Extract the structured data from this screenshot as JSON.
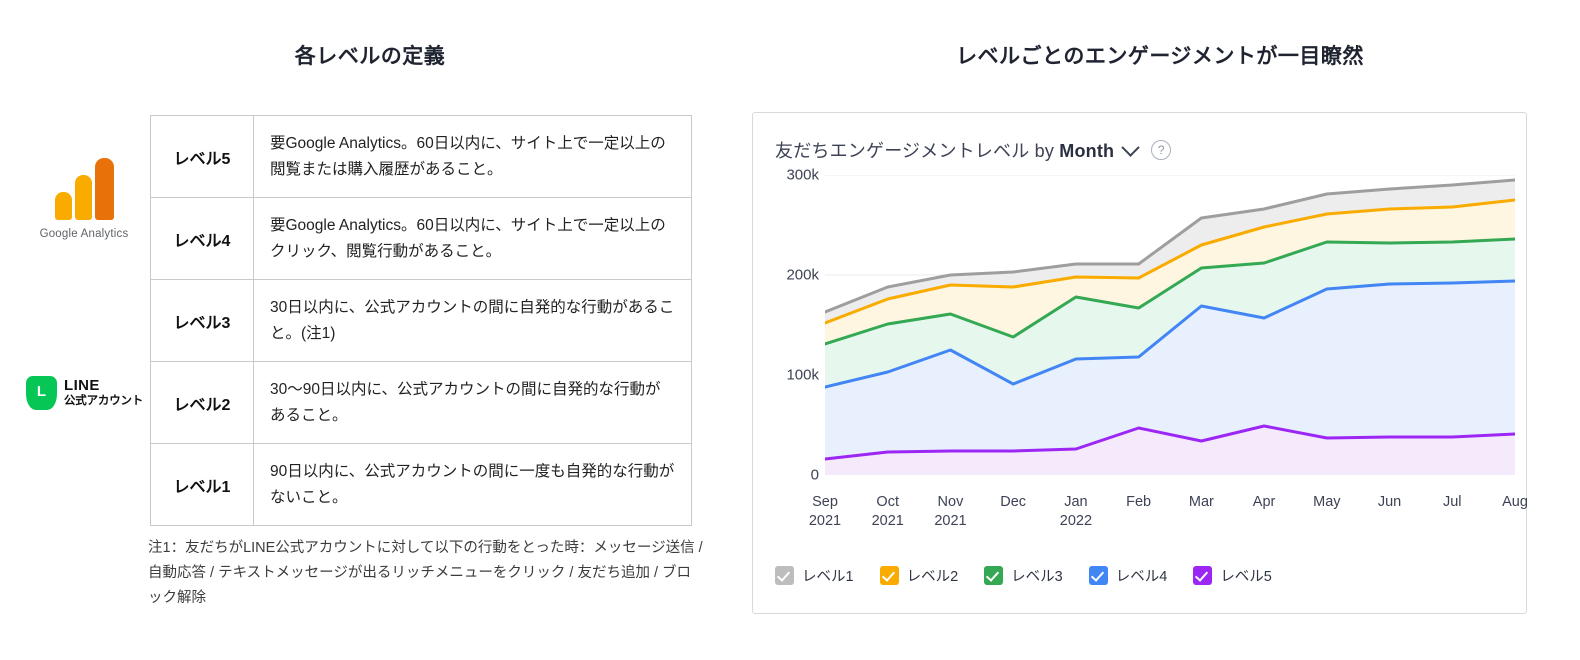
{
  "left": {
    "title": "各レベルの定義",
    "logos": {
      "ga": {
        "name": "google-analytics",
        "label": "Google Analytics"
      },
      "line": {
        "name": "line-official-account",
        "label_top": "LINE",
        "label_bottom": "公式アカウント"
      }
    },
    "rows": [
      {
        "level": "レベル5",
        "desc": "要Google Analytics。60日以内に、サイト上で一定以上の閲覧または購入履歴があること。",
        "bar_color": "#F99C0E",
        "source": "google-analytics"
      },
      {
        "level": "レベル4",
        "desc": "要Google Analytics。60日以内に、サイト上で一定以上のクリック、閲覧行動があること。",
        "bar_color": "#F99C0E",
        "source": "google-analytics"
      },
      {
        "level": "レベル3",
        "desc": "30日以内に、公式アカウントの間に自発的な行動があること。(注1)",
        "bar_color": "#06C309",
        "source": "line-official-account"
      },
      {
        "level": "レベル2",
        "desc": "30〜90日以内に、公式アカウントの間に自発的な行動があること。",
        "bar_color": "#06C309",
        "source": "line-official-account"
      },
      {
        "level": "レベル1",
        "desc": "90日以内に、公式アカウントの間に一度も自発的な行動がないこと。",
        "bar_color": "#06C309",
        "source": "line-official-account"
      }
    ],
    "footnote": "注1：友だちがLINE公式アカウントに対して以下の行動をとった時：メッセージ送信 / 自動応答 / テキストメッセージが出るリッチメニューをクリック / 友だち追加 / ブロック解除"
  },
  "right": {
    "title": "レベルごとのエンゲージメントが一目瞭然",
    "card": {
      "header_prefix": "友だちエンゲージメントレベル by ",
      "header_dimension": "Month",
      "dropdown_icon": "chevron-down-icon",
      "help_icon": "help-circle-icon"
    }
  },
  "chart_data": {
    "type": "area",
    "stacked": true,
    "title": "友だちエンゲージメントレベル by Month",
    "xlabel": "",
    "ylabel": "",
    "ylim": [
      0,
      300000
    ],
    "yticks": [
      0,
      100000,
      200000,
      300000
    ],
    "ytick_labels": [
      "0",
      "100k",
      "200k",
      "300k"
    ],
    "grid": true,
    "legend_position": "bottom",
    "categories": [
      "Sep 2021",
      "Oct 2021",
      "Nov 2021",
      "Dec",
      "Jan 2022",
      "Feb",
      "Mar",
      "Apr",
      "May",
      "Jun",
      "Jul",
      "Aug"
    ],
    "xtick_labels": [
      [
        "Sep",
        "2021"
      ],
      [
        "Oct",
        "2021"
      ],
      [
        "Nov",
        "2021"
      ],
      [
        "Dec",
        ""
      ],
      [
        "Jan",
        "2022"
      ],
      [
        "Feb",
        ""
      ],
      [
        "Mar",
        ""
      ],
      [
        "Apr",
        ""
      ],
      [
        "May",
        ""
      ],
      [
        "Jun",
        ""
      ],
      [
        "Jul",
        ""
      ],
      [
        "Aug",
        ""
      ]
    ],
    "series": [
      {
        "name": "レベル5",
        "color": "#9C27F5",
        "fill": "#F5E9FC",
        "values": [
          16000,
          23000,
          24000,
          24000,
          26000,
          47000,
          34000,
          49000,
          37000,
          38000,
          38000,
          41000
        ]
      },
      {
        "name": "レベル4",
        "color": "#4285F4",
        "fill": "#E8F0FE",
        "cumulative": [
          88000,
          103000,
          125000,
          91000,
          116000,
          118000,
          169000,
          157000,
          186000,
          191000,
          192000,
          194000
        ]
      },
      {
        "name": "レベル3",
        "color": "#34A853",
        "fill": "#E6F8EE",
        "cumulative": [
          131000,
          151000,
          161000,
          138000,
          178000,
          167000,
          207000,
          212000,
          233000,
          232000,
          233000,
          236000
        ]
      },
      {
        "name": "レベル2",
        "color": "#F9AB00",
        "fill": "#FEF6E0",
        "cumulative": [
          152000,
          176000,
          190000,
          188000,
          198000,
          197000,
          230000,
          248000,
          261000,
          266000,
          268000,
          275000
        ]
      },
      {
        "name": "レベル1",
        "color": "#9E9E9E",
        "fill": "#EDEDED",
        "cumulative": [
          163000,
          188000,
          200000,
          203000,
          211000,
          211000,
          257000,
          266000,
          281000,
          286000,
          290000,
          295000
        ]
      }
    ],
    "legend": [
      {
        "label": "レベル1",
        "color": "#BDBDBD",
        "checked": true
      },
      {
        "label": "レベル2",
        "color": "#F9AB00",
        "checked": true
      },
      {
        "label": "レベル3",
        "color": "#34A853",
        "checked": true
      },
      {
        "label": "レベル4",
        "color": "#4285F4",
        "checked": true
      },
      {
        "label": "レベル5",
        "color": "#9C27F5",
        "checked": true
      }
    ]
  }
}
